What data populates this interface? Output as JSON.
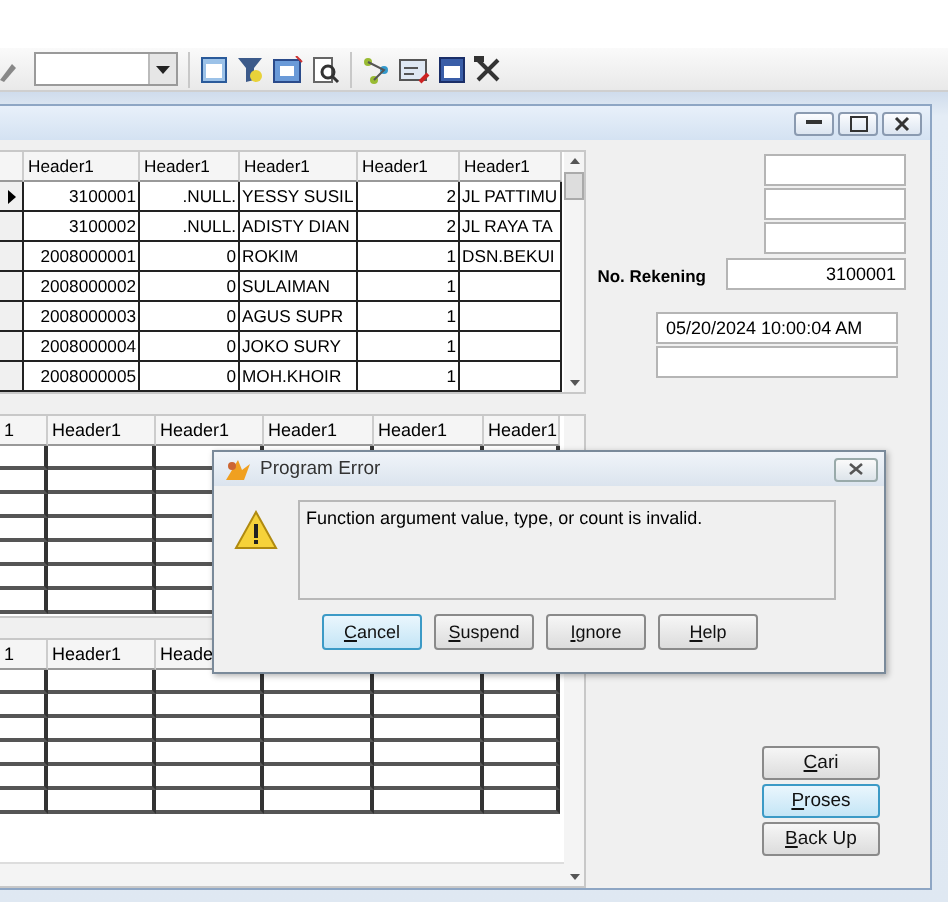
{
  "grid_top": {
    "columns": [
      "Header1",
      "Header1",
      "Header1",
      "Header1",
      "Header1"
    ],
    "rows": [
      {
        "current": true,
        "cells": [
          "3100001",
          ".NULL.",
          "YESSY SUSIL",
          "2",
          "JL PATTIMU"
        ]
      },
      {
        "current": false,
        "cells": [
          "3100002",
          ".NULL.",
          "ADISTY DIAN",
          "2",
          "JL RAYA TA"
        ]
      },
      {
        "current": false,
        "cells": [
          "2008000001",
          "0",
          "ROKIM",
          "1",
          "DSN.BEKUI"
        ]
      },
      {
        "current": false,
        "cells": [
          "2008000002",
          "0",
          "SULAIMAN",
          "1",
          ""
        ]
      },
      {
        "current": false,
        "cells": [
          "2008000003",
          "0",
          "AGUS SUPR",
          "1",
          ""
        ]
      },
      {
        "current": false,
        "cells": [
          "2008000004",
          "0",
          "JOKO SURY",
          "1",
          ""
        ]
      },
      {
        "current": false,
        "cells": [
          "2008000005",
          "0",
          "MOH.KHOIR",
          "1",
          ""
        ]
      }
    ]
  },
  "grid_middle": {
    "columns": [
      "1",
      "Header1",
      "Header1",
      "Header1",
      "Header1",
      "Header1"
    ]
  },
  "grid_bottom": {
    "columns": [
      "1",
      "Header1",
      "Heade"
    ]
  },
  "form": {
    "account_label": "No. Rekening",
    "account_value": "3100001",
    "timestamp": "05/20/2024 10:00:04 AM"
  },
  "buttons": [
    {
      "key": "C",
      "rest": "ari",
      "focused": false
    },
    {
      "key": "P",
      "rest": "roses",
      "focused": true
    },
    {
      "key": "B",
      "rest": "ack Up",
      "focused": false
    }
  ],
  "dialog": {
    "title": "Program Error",
    "message": "Function argument value, type, or count is invalid.",
    "buttons": [
      {
        "key": "C",
        "rest": "ancel",
        "focused": true
      },
      {
        "key": "S",
        "rest": "uspend",
        "focused": false
      },
      {
        "key": "I",
        "rest": "gnore",
        "focused": false
      },
      {
        "key": "H",
        "rest": "elp",
        "focused": false
      }
    ]
  }
}
